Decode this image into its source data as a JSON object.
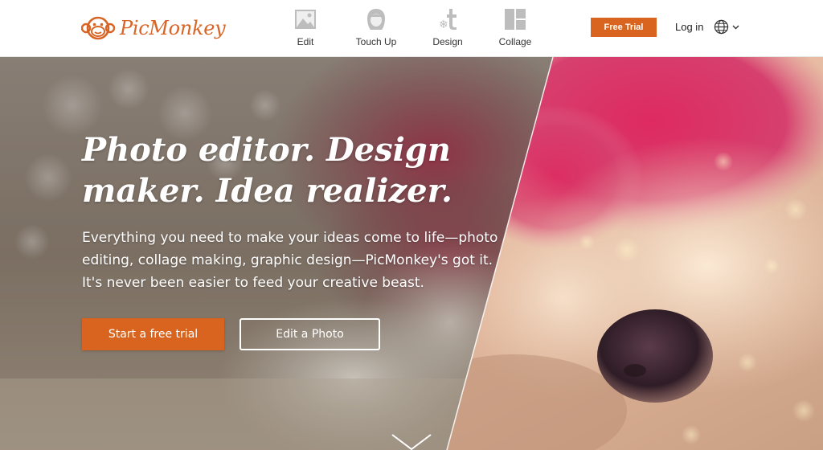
{
  "brand": {
    "name": "PicMonkey",
    "accent": "#d8641f"
  },
  "nav": {
    "items": [
      {
        "label": "Edit",
        "icon": "photo-icon"
      },
      {
        "label": "Touch Up",
        "icon": "face-icon"
      },
      {
        "label": "Design",
        "icon": "design-icon"
      },
      {
        "label": "Collage",
        "icon": "collage-icon"
      }
    ]
  },
  "header": {
    "trial_label": "Free Trial",
    "login_label": "Log in",
    "language_icon": "globe-icon"
  },
  "hero": {
    "title": "Photo editor. Design maker. Idea realizer.",
    "subtitle": "Everything you need to make your ideas come to life—photo editing, collage making, graphic design—PicMonkey's got it. It's never been easier to feed your creative beast.",
    "primary_cta": "Start a free trial",
    "secondary_cta": "Edit a Photo",
    "scroll_icon": "chevron-down-icon"
  }
}
